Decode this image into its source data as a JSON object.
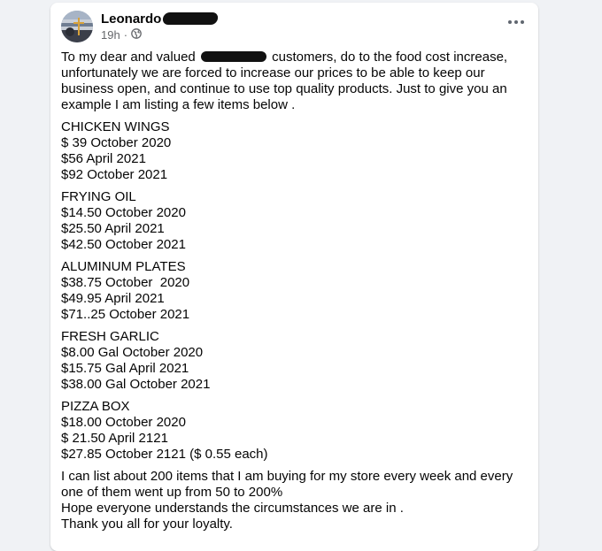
{
  "post": {
    "author_name": "Leonardo",
    "timestamp": "19h",
    "separator": "·",
    "audience_icon": "globe-icon",
    "menu_icon": "more-options-icon",
    "intro_before": "To my dear and valued",
    "intro_after": "customers, do to the food cost increase, unfortunately we are forced to increase our prices to be able to keep our business open, and continue to use top quality products. Just to give you an example I am listing a few items below .",
    "items": [
      {
        "name": "CHICKEN WINGS",
        "lines": [
          "$ 39 October 2020",
          "$56 April 2021",
          "$92 October 2021"
        ]
      },
      {
        "name": "FRYING OIL",
        "lines": [
          "$14.50 October 2020",
          "$25.50 April 2021",
          "$42.50 October 2021"
        ]
      },
      {
        "name": "ALUMINUM PLATES",
        "lines": [
          "$38.75 October  2020",
          "$49.95 April 2021",
          "$71..25 October 2021"
        ]
      },
      {
        "name": "FRESH GARLIC",
        "lines": [
          "$8.00 Gal October 2020",
          "$15.75 Gal April 2021",
          "$38.00 Gal October 2021"
        ]
      },
      {
        "name": "PIZZA BOX",
        "lines": [
          "$18.00 October 2020",
          "$ 21.50 April 2121",
          "$27.85 October 2121 ($ 0.55 each)"
        ]
      }
    ],
    "closing": [
      "I can list about 200 items that I am buying for my store every week and every one of them went up from 50 to 200%",
      "Hope everyone understands the circumstances we are in .",
      "Thank you all for your loyalty."
    ]
  }
}
